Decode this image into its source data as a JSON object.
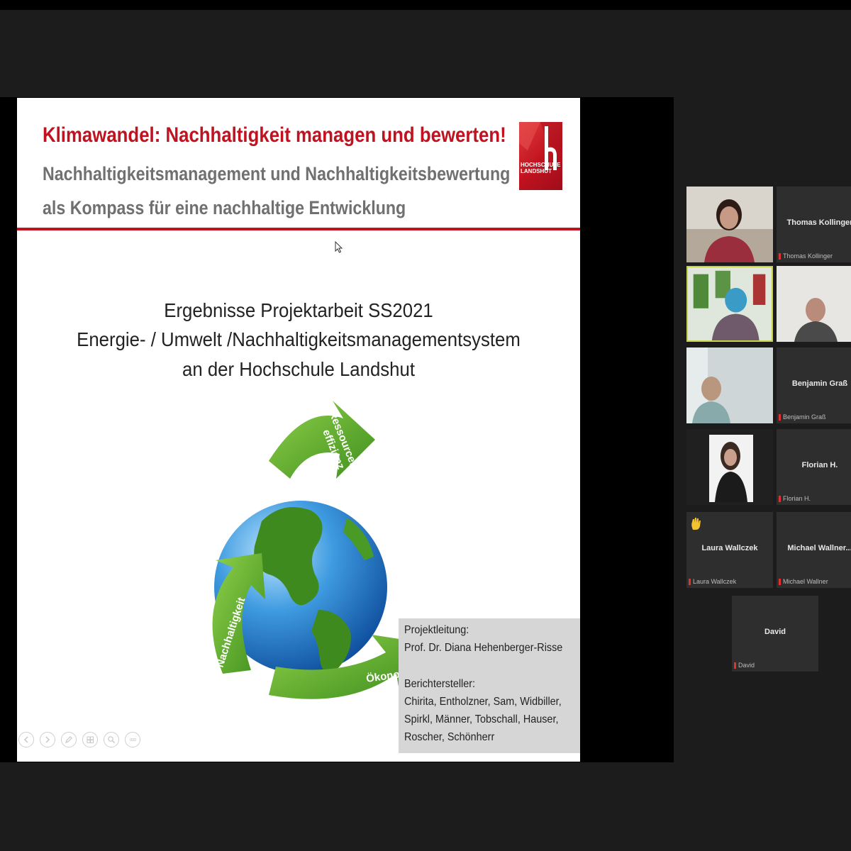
{
  "slide": {
    "title": "Klimawandel: Nachhaltigkeit managen und bewerten!",
    "subtitle_line1": "Nachhaltigkeitsmanagement und Nachhaltigkeitsbewertung",
    "subtitle_line2": "als Kompass für eine nachhaltige Entwicklung",
    "logo_text_line1": "HOCHSCHULE",
    "logo_text_line2": "LANDSHUT",
    "heading_line1": "Ergebnisse Projektarbeit SS2021",
    "heading_line2": "Energie- / Umwelt /Nachhaltigkeitsmanagementsystem",
    "heading_line3": "an der Hochschule Landshut",
    "arrow_labels": {
      "top_line1": "Ressourcen-",
      "top_line2": "effizienz",
      "left": "Nachhaltigkeit",
      "bottom": "Ökonomie"
    },
    "info": {
      "lead_label": "Projektleitung:",
      "lead_name": "Prof. Dr. Diana Hehenberger-Risse",
      "reporters_label": "Berichtersteller:",
      "reporters_line1": "Chirita, Entholzner, Sam, Widbiller,",
      "reporters_line2": "Spirkl, Männer, Tobschall, Hauser,",
      "reporters_line3": "Roscher, Schönherr"
    },
    "colors": {
      "accent": "#c0121f",
      "subtitle": "#707070",
      "arrow_green": "#5aaa2c"
    }
  },
  "presenter_controls": {
    "icons": [
      "prev-icon",
      "next-icon",
      "pen-icon",
      "slides-icon",
      "zoom-icon",
      "more-icon"
    ],
    "more_glyph": "ooo"
  },
  "participants": [
    {
      "id": "p1",
      "name": "",
      "video": true
    },
    {
      "id": "p2",
      "name": "Thomas Kollinger",
      "label": "Thomas Kollinger",
      "video": false
    },
    {
      "id": "p3",
      "name": "",
      "video": true,
      "active": true
    },
    {
      "id": "p4",
      "name": "",
      "video": true
    },
    {
      "id": "p5",
      "name": "",
      "video": true
    },
    {
      "id": "p6",
      "name": "Benjamin Graß",
      "label": "Benjamin Graß",
      "video": false
    },
    {
      "id": "p7",
      "name": "",
      "video": true
    },
    {
      "id": "p8",
      "name": "Florian H.",
      "label": "Florian H.",
      "video": false
    },
    {
      "id": "p9",
      "name": "Laura Wallczek",
      "label": "Laura Wallczek",
      "video": false,
      "raised_hand": true
    },
    {
      "id": "p10",
      "name": "Michael Wallner...",
      "label": "Michael Wallner",
      "video": false
    },
    {
      "id": "p11",
      "name": "David",
      "label": "David",
      "video": false
    }
  ]
}
